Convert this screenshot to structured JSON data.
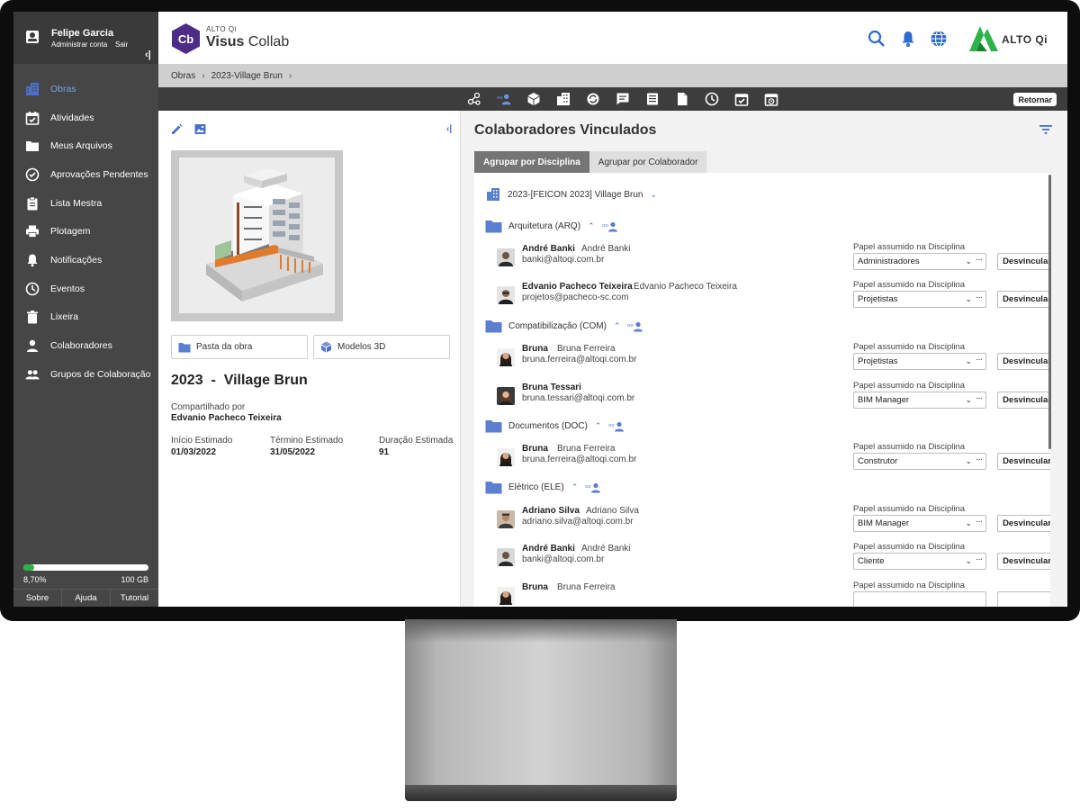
{
  "user": {
    "name": "Felipe Garcia",
    "admin_label": "Administrar conta",
    "exit_label": "Sair"
  },
  "sidebar": {
    "items": [
      {
        "label": "Obras",
        "icon": "building-icon",
        "active": true
      },
      {
        "label": "Atividades",
        "icon": "calendar-check-icon"
      },
      {
        "label": "Meus Arquivos",
        "icon": "folder-icon"
      },
      {
        "label": "Aprovações Pendentes",
        "icon": "check-circle-icon"
      },
      {
        "label": "Lista Mestra",
        "icon": "clipboard-icon"
      },
      {
        "label": "Plotagem",
        "icon": "printer-icon"
      },
      {
        "label": "Notificações",
        "icon": "bell-icon"
      },
      {
        "label": "Eventos",
        "icon": "clock-icon"
      },
      {
        "label": "Lixeira",
        "icon": "trash-icon"
      },
      {
        "label": "Colaboradores",
        "icon": "person-icon"
      },
      {
        "label": "Grupos de Colaboração",
        "icon": "group-icon"
      }
    ],
    "storage": {
      "used_label": "8,70%",
      "total_label": "100 GB",
      "used_fraction": 0.087
    },
    "footer": [
      "Sobre",
      "Ajuda",
      "Tutorial"
    ]
  },
  "header": {
    "brand_small": "ALTO Qi",
    "app_name_bold": "Visus",
    "app_name_light": " Collab",
    "logo_text": "Cb",
    "company": "ALTO Qi",
    "accent": "#2d6ad4",
    "logo_color": "#4d2c86",
    "altoqi_green": "#2db34a"
  },
  "breadcrumb": [
    "Obras",
    "2023-Village Brun"
  ],
  "toolbar": {
    "return_label": "Retornar"
  },
  "project": {
    "title": "2023  -  Village Brun",
    "shared_label": "Compartilhado por",
    "shared_by": "Edvanio Pacheco Teixeira",
    "folder_button": "Pasta da obra",
    "models_button": "Modelos 3D",
    "dates": [
      {
        "label": "Início Estimado",
        "value": "01/03/2022"
      },
      {
        "label": "Término Estimado",
        "value": "31/05/2022"
      },
      {
        "label": "Duração Estimada",
        "value": "91"
      }
    ]
  },
  "collaborators": {
    "title": "Colaboradores Vinculados",
    "tabs": [
      "Agrupar por Disciplina",
      "Agrupar por Colaborador"
    ],
    "project_name": "2023-[FEICON 2023] Village Brun",
    "role_label": "Papel assumido na Disciplina",
    "unlink_label": "Desvincular",
    "disciplines": [
      {
        "name": "Arquitetura (ARQ)",
        "people": [
          {
            "short": "André Banki",
            "full": "André Banki",
            "email": "banki@altoqi.com.br",
            "role": "Administradores"
          },
          {
            "short": "Edvanio Pacheco Teixeira",
            "full": "Edvanio Pacheco Teixeira",
            "email": "projetos@pacheco-sc.com",
            "role": "Projetistas"
          }
        ]
      },
      {
        "name": "Compatibilização (COM)",
        "people": [
          {
            "short": "Bruna",
            "full": "Bruna Ferreira",
            "email": "bruna.ferreira@altoqi.com.br",
            "role": "Projetistas"
          },
          {
            "short": "Bruna Tessari",
            "full": "",
            "email": "bruna.tessari@altoqi.com.br",
            "role": "BIM Manager"
          }
        ]
      },
      {
        "name": "Documentos (DOC)",
        "people": [
          {
            "short": "Bruna",
            "full": "Bruna Ferreira",
            "email": "bruna.ferreira@altoqi.com.br",
            "role": "Construtor"
          }
        ]
      },
      {
        "name": "Elétrico (ELE)",
        "people": [
          {
            "short": "Adriano Silva",
            "full": "Adriano Silva",
            "email": "adriano.silva@altoqi.com.br",
            "role": "BIM Manager"
          },
          {
            "short": "André Banki",
            "full": "André Banki",
            "email": "banki@altoqi.com.br",
            "role": "Cliente"
          },
          {
            "short": "Bruna",
            "full": "Bruna Ferreira",
            "email": "",
            "role": ""
          }
        ]
      }
    ]
  }
}
